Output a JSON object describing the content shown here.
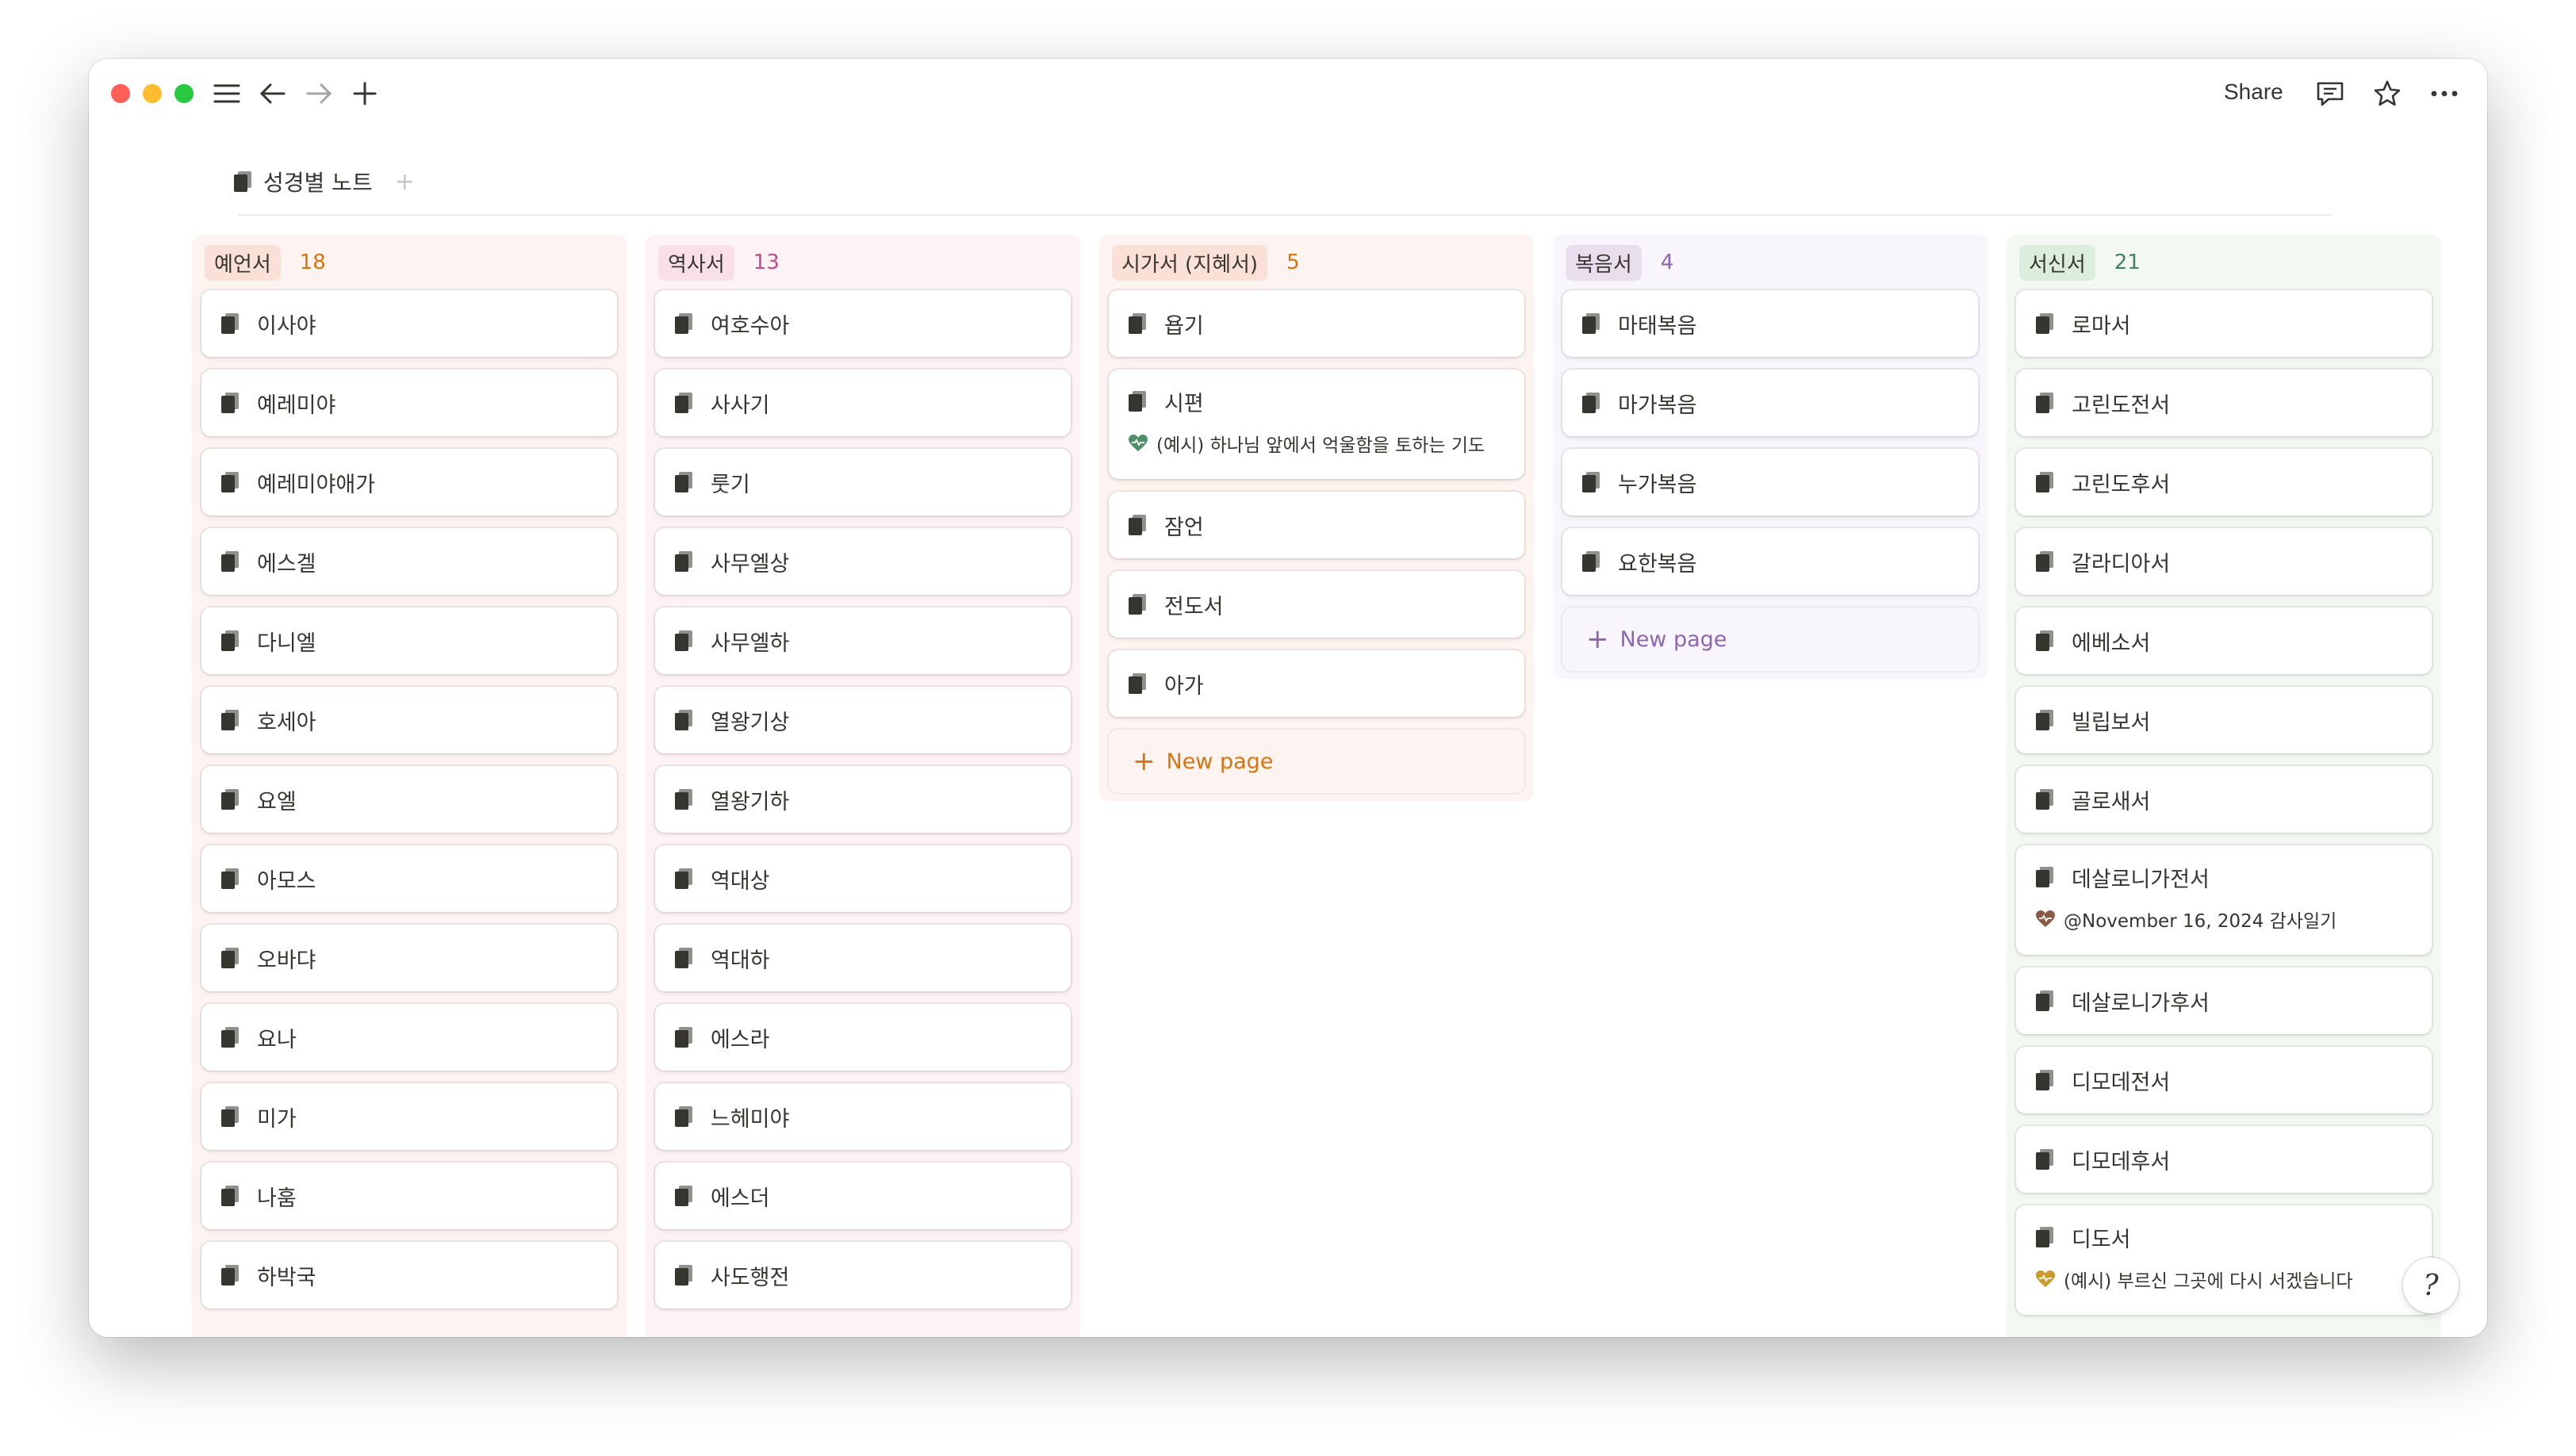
{
  "toolbar": {
    "share_label": "Share",
    "icons": [
      "sidebar-menu-icon",
      "back-arrow-icon",
      "forward-arrow-icon",
      "new-tab-plus-icon",
      "comment-icon",
      "star-icon",
      "more-icon"
    ]
  },
  "database": {
    "title": "성경별 노트",
    "add_view": "+"
  },
  "columns": [
    {
      "label": "예언서",
      "count": "18",
      "colors": {
        "bg": "#fdf4f1",
        "pill": "#fbe0d8",
        "count": "#d9730d"
      },
      "cards": [
        {
          "title": "이사야"
        },
        {
          "title": "예레미야"
        },
        {
          "title": "예레미야애가"
        },
        {
          "title": "에스겔"
        },
        {
          "title": "다니엘"
        },
        {
          "title": "호세아"
        },
        {
          "title": "요엘"
        },
        {
          "title": "아모스"
        },
        {
          "title": "오바댜"
        },
        {
          "title": "요나"
        },
        {
          "title": "미가"
        },
        {
          "title": "나훔"
        },
        {
          "title": "하박국"
        }
      ]
    },
    {
      "label": "역사서",
      "count": "13",
      "colors": {
        "bg": "#fdf2f6",
        "pill": "#f8dfea",
        "count": "#c14c8a"
      },
      "cards": [
        {
          "title": "여호수아"
        },
        {
          "title": "사사기"
        },
        {
          "title": "룻기"
        },
        {
          "title": "사무엘상"
        },
        {
          "title": "사무엘하"
        },
        {
          "title": "열왕기상"
        },
        {
          "title": "열왕기하"
        },
        {
          "title": "역대상"
        },
        {
          "title": "역대하"
        },
        {
          "title": "에스라"
        },
        {
          "title": "느헤미야"
        },
        {
          "title": "에스더"
        },
        {
          "title": "사도행전"
        }
      ]
    },
    {
      "label": "시가서 (지혜서)",
      "count": "5",
      "colors": {
        "bg": "#fdf4f1",
        "pill": "#fbe0d8",
        "count": "#d9730d"
      },
      "cards": [
        {
          "title": "욥기"
        },
        {
          "title": "시편",
          "sub": "(예시) 하나님 앞에서 억울함을 토하는 기도",
          "sub_icon": "green-heart-icon"
        },
        {
          "title": "잠언"
        },
        {
          "title": "전도서"
        },
        {
          "title": "아가"
        }
      ],
      "new_page": "New page"
    },
    {
      "label": "복음서",
      "count": "4",
      "colors": {
        "bg": "#f8f5fc",
        "pill": "#e8deee",
        "count": "#9065b0"
      },
      "cards": [
        {
          "title": "마태복음"
        },
        {
          "title": "마가복음"
        },
        {
          "title": "누가복음"
        },
        {
          "title": "요한복음"
        }
      ],
      "new_page": "New page"
    },
    {
      "label": "서신서",
      "count": "21",
      "colors": {
        "bg": "#f4f8f3",
        "pill": "#dbeddb",
        "count": "#448361"
      },
      "cards": [
        {
          "title": "로마서"
        },
        {
          "title": "고린도전서"
        },
        {
          "title": "고린도후서"
        },
        {
          "title": "갈라디아서"
        },
        {
          "title": "에베소서"
        },
        {
          "title": "빌립보서"
        },
        {
          "title": "골로새서"
        },
        {
          "title": "데살로니가전서",
          "sub": "@November 16, 2024 감사일기",
          "sub_icon": "brown-heart-icon"
        },
        {
          "title": "데살로니가후서"
        },
        {
          "title": "디모데전서"
        },
        {
          "title": "디모데후서"
        },
        {
          "title": "디도서",
          "sub": "(예시) 부르신 그곳에 다시 서겠습니다",
          "sub_icon": "yellow-heart-icon"
        }
      ]
    }
  ],
  "help_button": "?"
}
